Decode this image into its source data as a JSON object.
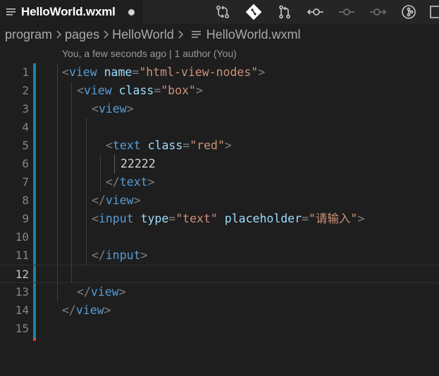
{
  "tab": {
    "title": "HelloWorld.wxml",
    "unsaved": true
  },
  "toolbar": {
    "icons": [
      "compare-changes-icon",
      "git-branch-icon",
      "pull-request-icon",
      "previous-commit-icon",
      "commit-icon",
      "next-commit-icon",
      "open-remote-icon"
    ]
  },
  "breadcrumb": {
    "segments": [
      "program",
      "pages",
      "HelloWorld",
      "HelloWorld.wxml"
    ]
  },
  "codelens": "You, a few seconds ago | 1 author (You)",
  "editor": {
    "active_line": 12,
    "lines": [
      {
        "n": "1",
        "tokens": [
          [
            "punc",
            "<"
          ],
          [
            "tag",
            "view"
          ],
          [
            "txt",
            " "
          ],
          [
            "attr",
            "name"
          ],
          [
            "punc",
            "="
          ],
          [
            "str",
            "\"html-view-nodes\""
          ],
          [
            "punc",
            ">"
          ]
        ]
      },
      {
        "n": "2",
        "tokens": [
          [
            "punc",
            "<"
          ],
          [
            "tag",
            "view"
          ],
          [
            "txt",
            " "
          ],
          [
            "attr",
            "class"
          ],
          [
            "punc",
            "="
          ],
          [
            "str",
            "\"box\""
          ],
          [
            "punc",
            ">"
          ]
        ]
      },
      {
        "n": "3",
        "tokens": [
          [
            "punc",
            "<"
          ],
          [
            "tag",
            "view"
          ],
          [
            "punc",
            ">"
          ]
        ]
      },
      {
        "n": "4",
        "tokens": []
      },
      {
        "n": "5",
        "tokens": [
          [
            "punc",
            "<"
          ],
          [
            "tag",
            "text"
          ],
          [
            "txt",
            " "
          ],
          [
            "attr",
            "class"
          ],
          [
            "punc",
            "="
          ],
          [
            "str",
            "\"red\""
          ],
          [
            "punc",
            ">"
          ]
        ]
      },
      {
        "n": "6",
        "tokens": [
          [
            "txt",
            "22222"
          ]
        ]
      },
      {
        "n": "7",
        "tokens": [
          [
            "punc",
            "</"
          ],
          [
            "tag",
            "text"
          ],
          [
            "punc",
            ">"
          ]
        ]
      },
      {
        "n": "8",
        "tokens": [
          [
            "punc",
            "</"
          ],
          [
            "tag",
            "view"
          ],
          [
            "punc",
            ">"
          ]
        ]
      },
      {
        "n": "9",
        "tokens": [
          [
            "punc",
            "<"
          ],
          [
            "tag",
            "input"
          ],
          [
            "txt",
            " "
          ],
          [
            "attr",
            "type"
          ],
          [
            "punc",
            "="
          ],
          [
            "str",
            "\"text\""
          ],
          [
            "txt",
            " "
          ],
          [
            "attr",
            "placeholder"
          ],
          [
            "punc",
            "="
          ],
          [
            "str",
            "\"请输入\""
          ],
          [
            "punc",
            ">"
          ]
        ]
      },
      {
        "n": "10",
        "tokens": []
      },
      {
        "n": "11",
        "tokens": [
          [
            "punc",
            "</"
          ],
          [
            "tag",
            "input"
          ],
          [
            "punc",
            ">"
          ]
        ]
      },
      {
        "n": "12",
        "tokens": []
      },
      {
        "n": "13",
        "tokens": [
          [
            "punc",
            "</"
          ],
          [
            "tag",
            "view"
          ],
          [
            "punc",
            ">"
          ]
        ]
      },
      {
        "n": "14",
        "tokens": [
          [
            "punc",
            "</"
          ],
          [
            "tag",
            "view"
          ],
          [
            "punc",
            ">"
          ]
        ]
      },
      {
        "n": "15",
        "tokens": []
      }
    ]
  },
  "colors": {
    "background": "#1e1e1e",
    "tag": "#569cd6",
    "attribute": "#9cdcfe",
    "string": "#ce9178",
    "punctuation": "#808080",
    "git_modified": "#1b81a8"
  }
}
